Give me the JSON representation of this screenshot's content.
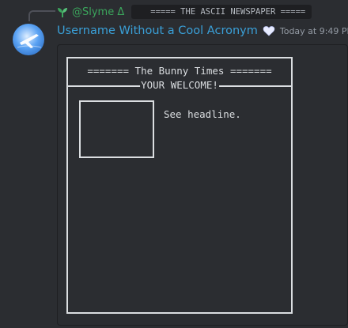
{
  "reply": {
    "user": "@Slyme Δ",
    "preview": "===== THE ASCII NEWSPAPER =====",
    "icon": "plant-icon"
  },
  "message": {
    "username": "Username Without a Cool Acronym",
    "badge_icon": "heart-icon",
    "timestamp": "Today at 9:49 PM",
    "avatar_icon": "airplane-avatar"
  },
  "newspaper": {
    "masthead": "======= The Bunny Times =======",
    "tagline": "YOUR WELCOME!",
    "headline_note": "See headline."
  },
  "colors": {
    "background": "#2b2d31",
    "username": "#3aa0d8",
    "reply_user": "#3ba55c",
    "text": "#dbdee1",
    "muted": "#949ba4"
  }
}
